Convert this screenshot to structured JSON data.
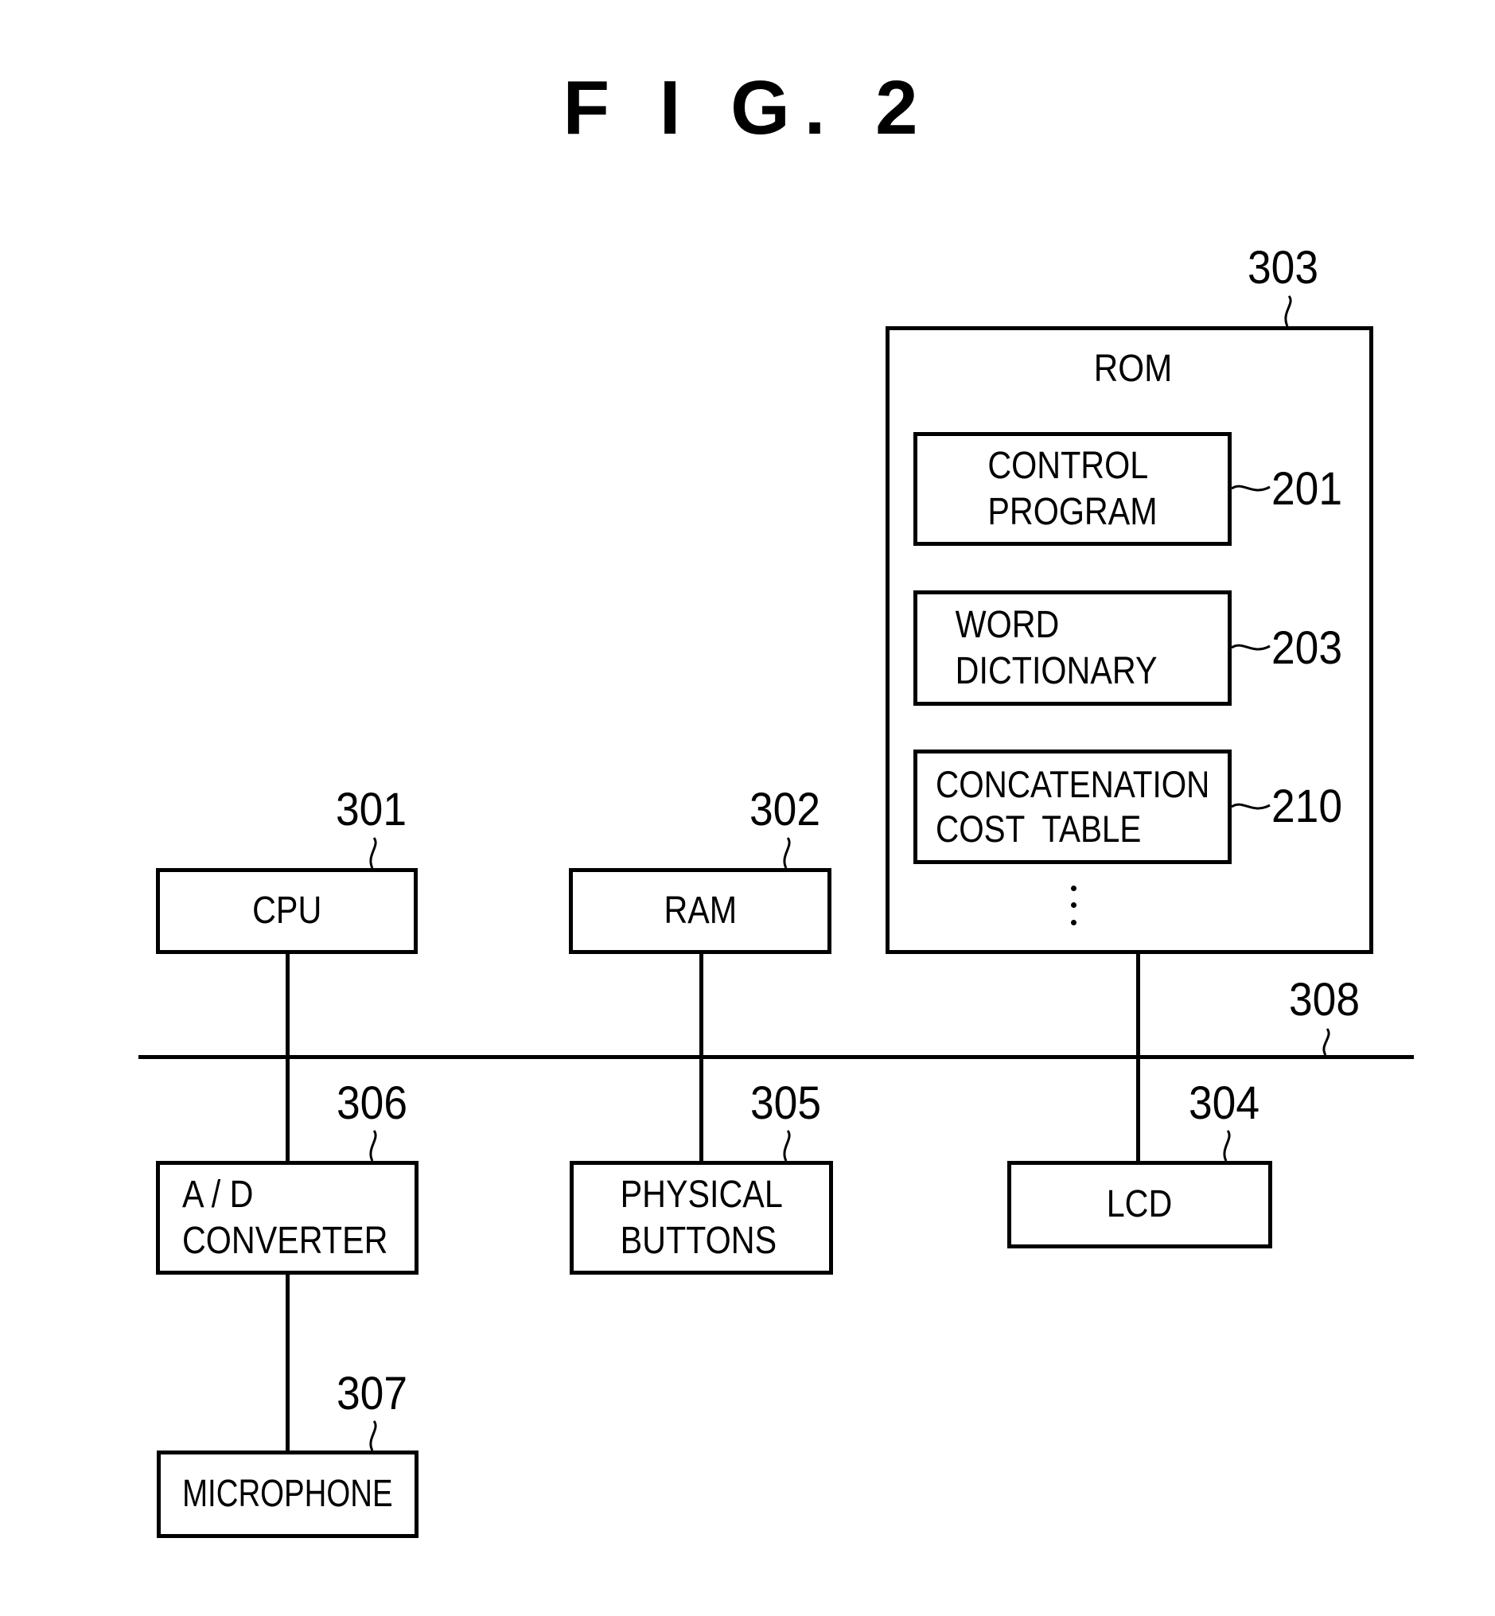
{
  "figure": {
    "title": "F I G.  2"
  },
  "bus": {
    "ref": "308"
  },
  "components": {
    "cpu": {
      "label": "CPU",
      "ref": "301"
    },
    "ram": {
      "label": "RAM",
      "ref": "302"
    },
    "rom": {
      "label": "ROM",
      "ref": "303",
      "contents": [
        {
          "label": "CONTROL\nPROGRAM",
          "ref": "201"
        },
        {
          "label": "WORD\nDICTIONARY",
          "ref": "203"
        },
        {
          "label": "CONCATENATION\nCOST  TABLE",
          "ref": "210"
        }
      ],
      "continuation": "⋮"
    },
    "lcd": {
      "label": "LCD",
      "ref": "304"
    },
    "physical_buttons": {
      "label": "PHYSICAL\nBUTTONS",
      "ref": "305"
    },
    "ad_converter": {
      "label": "A / D\nCONVERTER",
      "ref": "306"
    },
    "microphone": {
      "label": "MICROPHONE",
      "ref": "307"
    }
  }
}
